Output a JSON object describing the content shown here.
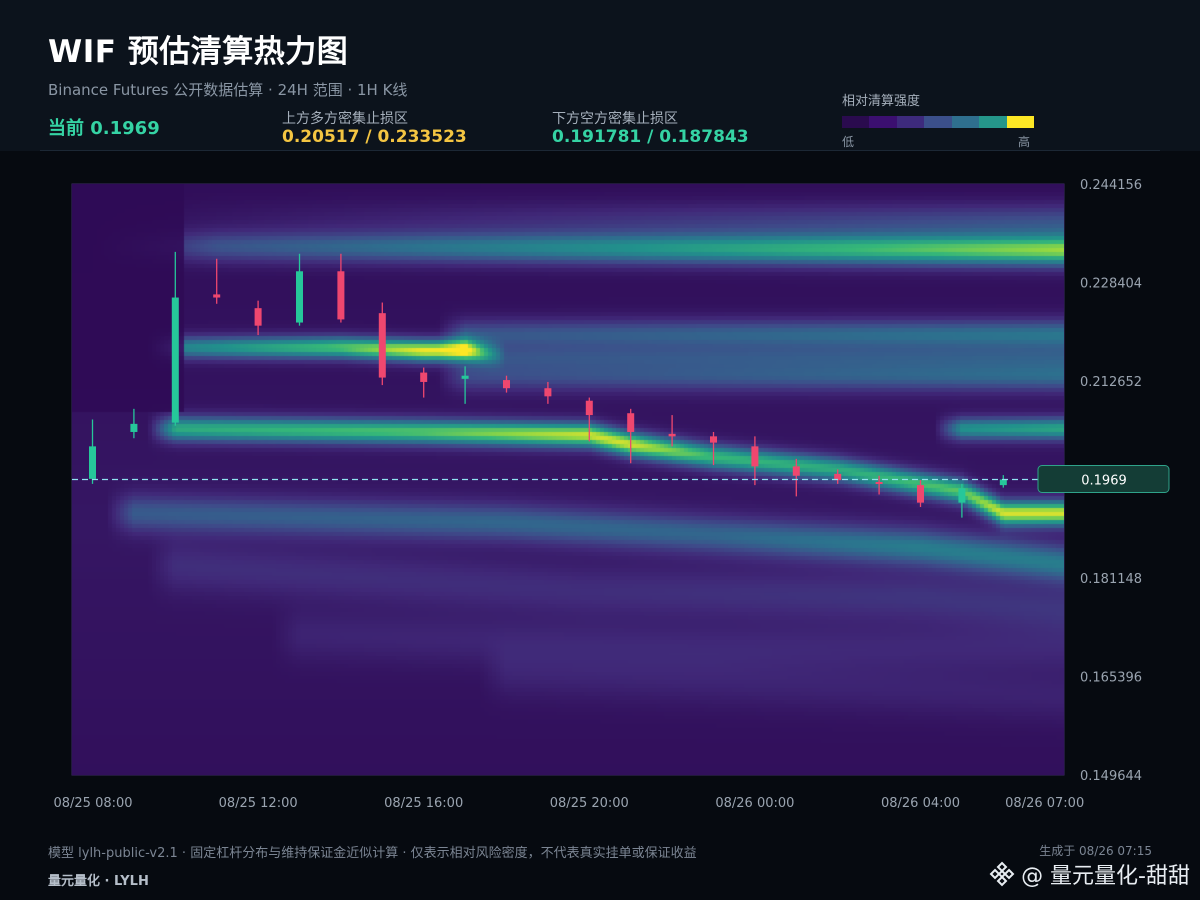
{
  "header": {
    "title": "WIF 预估清算热力图",
    "subtitle": "Binance Futures 公开数据估算 · 24H 范围 · 1H K线",
    "current": "当前 0.1969",
    "upper_label": "上方多方密集止损区",
    "upper_value": "0.20517 / 0.233523",
    "lower_label": "下方空方密集止损区",
    "lower_value": "0.191781 / 0.187843",
    "legend_title": "相对清算强度",
    "legend_low": "低",
    "legend_high": "高"
  },
  "colors": {
    "up": "#26c79a",
    "down": "#ef476f",
    "upper_zone": "#f4c542",
    "lower_zone": "#35d3a4",
    "legend": [
      "#2a0b4e",
      "#3b0f70",
      "#3d2a7c",
      "#3b4f8a",
      "#2f6f8e",
      "#25968a",
      "#fde725"
    ]
  },
  "footer": {
    "note": "模型 lylh-public-v2.1 · 固定杠杆分布与维持保证金近似计算 · 仅表示相对风险密度，不代表真实挂单或保证收益",
    "brand": "量元量化 · LYLH",
    "generated": "生成于 08/26 07:15",
    "watermark": "@ 量元量化-甜甜"
  },
  "chart_data": {
    "type": "heatmap",
    "ylim": [
      0.149644,
      0.244156
    ],
    "y_ticks": [
      "0.244156",
      "0.228404",
      "0.212652",
      "0.196900",
      "0.181148",
      "0.165396",
      "0.149644"
    ],
    "x_tick_labels": [
      "08/25 08:00",
      "08/25 12:00",
      "08/25 16:00",
      "08/25 20:00",
      "08/26 00:00",
      "08/26 04:00",
      "08/26 07:00"
    ],
    "current_price": 0.1969,
    "current_price_label": "0.1969",
    "candles": [
      {
        "o": 0.197,
        "h": 0.2065,
        "l": 0.1962,
        "c": 0.2022
      },
      {
        "o": 0.2045,
        "h": 0.2082,
        "l": 0.2035,
        "c": 0.2058
      },
      {
        "o": 0.206,
        "h": 0.2333,
        "l": 0.2055,
        "c": 0.226
      },
      {
        "o": 0.2265,
        "h": 0.2322,
        "l": 0.225,
        "c": 0.226
      },
      {
        "o": 0.2243,
        "h": 0.2255,
        "l": 0.22,
        "c": 0.2215
      },
      {
        "o": 0.222,
        "h": 0.233,
        "l": 0.2215,
        "c": 0.2302
      },
      {
        "o": 0.2302,
        "h": 0.233,
        "l": 0.222,
        "c": 0.2225
      },
      {
        "o": 0.2235,
        "h": 0.2252,
        "l": 0.212,
        "c": 0.2132
      },
      {
        "o": 0.214,
        "h": 0.2148,
        "l": 0.21,
        "c": 0.2125
      },
      {
        "o": 0.213,
        "h": 0.215,
        "l": 0.209,
        "c": 0.2135
      },
      {
        "o": 0.2128,
        "h": 0.2135,
        "l": 0.2108,
        "c": 0.2115
      },
      {
        "o": 0.2115,
        "h": 0.2125,
        "l": 0.209,
        "c": 0.2102
      },
      {
        "o": 0.2095,
        "h": 0.21,
        "l": 0.203,
        "c": 0.2072
      },
      {
        "o": 0.2075,
        "h": 0.2082,
        "l": 0.1995,
        "c": 0.2045
      },
      {
        "o": 0.2042,
        "h": 0.2072,
        "l": 0.2022,
        "c": 0.2038
      },
      {
        "o": 0.2038,
        "h": 0.2045,
        "l": 0.1992,
        "c": 0.2028
      },
      {
        "o": 0.2022,
        "h": 0.2038,
        "l": 0.196,
        "c": 0.199
      },
      {
        "o": 0.199,
        "h": 0.2002,
        "l": 0.1942,
        "c": 0.1975
      },
      {
        "o": 0.1978,
        "h": 0.1985,
        "l": 0.1962,
        "c": 0.1968
      },
      {
        "o": 0.1965,
        "h": 0.1975,
        "l": 0.1945,
        "c": 0.1962
      },
      {
        "o": 0.196,
        "h": 0.1968,
        "l": 0.1925,
        "c": 0.1932
      },
      {
        "o": 0.1932,
        "h": 0.1962,
        "l": 0.1908,
        "c": 0.1955
      },
      {
        "o": 0.196,
        "h": 0.1976,
        "l": 0.1956,
        "c": 0.1969
      }
    ],
    "heat_bands": [
      {
        "path": [
          [
            0,
            0.2341
          ],
          [
            3,
            0.2341
          ],
          [
            24,
            0.2335
          ]
        ],
        "w": 0.0025,
        "i": [
          0.0,
          0.3,
          0.85
        ]
      },
      {
        "path": [
          [
            0,
            0.2385
          ],
          [
            24,
            0.238
          ]
        ],
        "w": 0.003,
        "i": [
          0.0,
          0.3,
          0.5
        ]
      },
      {
        "path": [
          [
            2,
            0.218
          ],
          [
            6,
            0.218
          ],
          [
            8,
            0.2175
          ],
          [
            9,
            0.2175
          ],
          [
            10,
            0.2165
          ]
        ],
        "w": 0.0018,
        "i": [
          0.5,
          0.75,
          0.95,
          0.95,
          0.2
        ]
      },
      {
        "path": [
          [
            9,
            0.22
          ],
          [
            24,
            0.22
          ]
        ],
        "w": 0.0025,
        "i": [
          0.3,
          0.45,
          0.45
        ]
      },
      {
        "path": [
          [
            9,
            0.2135
          ],
          [
            24,
            0.2135
          ]
        ],
        "w": 0.0025,
        "i": [
          0.25,
          0.4,
          0.4
        ]
      },
      {
        "path": [
          [
            2,
            0.205
          ],
          [
            8,
            0.2045
          ],
          [
            12,
            0.204
          ],
          [
            13,
            0.2025
          ],
          [
            15,
            0.2005
          ],
          [
            18,
            0.1985
          ],
          [
            21,
            0.195
          ],
          [
            22,
            0.1915
          ],
          [
            24,
            0.1915
          ]
        ],
        "w": 0.002,
        "i": [
          0.65,
          0.75,
          0.9,
          0.9,
          0.7,
          0.65,
          0.75,
          0.9,
          0.9
        ]
      },
      {
        "path": [
          [
            21,
            0.205
          ],
          [
            24,
            0.205
          ]
        ],
        "w": 0.0018,
        "i": [
          0.55,
          0.65,
          0.65
        ]
      },
      {
        "path": [
          [
            1,
            0.1915
          ],
          [
            10,
            0.19
          ],
          [
            15,
            0.188
          ],
          [
            20,
            0.186
          ],
          [
            24,
            0.183
          ]
        ],
        "w": 0.003,
        "i": [
          0.3,
          0.35,
          0.35,
          0.45,
          0.45
        ]
      },
      {
        "path": [
          [
            2,
            0.183
          ],
          [
            12,
            0.179
          ],
          [
            20,
            0.178
          ],
          [
            24,
            0.176
          ]
        ],
        "w": 0.004,
        "i": [
          0.12,
          0.12,
          0.15,
          0.15
        ]
      },
      {
        "path": [
          [
            5,
            0.172
          ],
          [
            15,
            0.17
          ],
          [
            24,
            0.17
          ]
        ],
        "w": 0.004,
        "i": [
          0.08,
          0.1,
          0.1
        ]
      },
      {
        "path": [
          [
            10,
            0.166
          ],
          [
            24,
            0.162
          ]
        ],
        "w": 0.004,
        "i": [
          0.08,
          0.08
        ]
      }
    ]
  }
}
